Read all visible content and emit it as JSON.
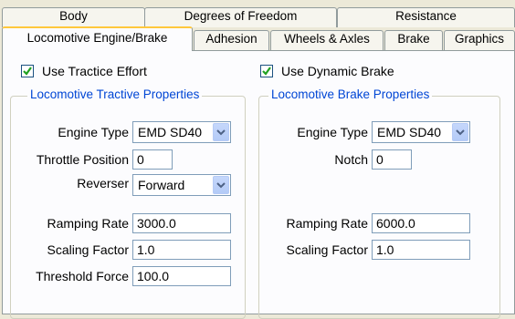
{
  "tabs_top": [
    {
      "label": "Body"
    },
    {
      "label": "Degrees of Freedom"
    },
    {
      "label": "Resistance"
    }
  ],
  "tabs_bottom": [
    {
      "label": "Locomotive Engine/Brake",
      "active": true
    },
    {
      "label": "Adhesion"
    },
    {
      "label": "Wheels & Axles"
    },
    {
      "label": "Brake"
    },
    {
      "label": "Graphics"
    }
  ],
  "tractive": {
    "checkbox_label": "Use Tractice Effort",
    "checked": true,
    "group_title": "Locomotive Tractive Properties",
    "engine_type_label": "Engine Type",
    "engine_type_value": "EMD SD40",
    "throttle_label": "Throttle Position",
    "throttle_value": "0",
    "reverser_label": "Reverser",
    "reverser_value": "Forward",
    "ramping_label": "Ramping Rate",
    "ramping_value": "3000.0",
    "scaling_label": "Scaling Factor",
    "scaling_value": "1.0",
    "threshold_label": "Threshold Force",
    "threshold_value": "100.0"
  },
  "brake": {
    "checkbox_label": "Use Dynamic Brake",
    "checked": true,
    "group_title": "Locomotive Brake Properties",
    "engine_type_label": "Engine Type",
    "engine_type_value": "EMD SD40",
    "notch_label": "Notch",
    "notch_value": "0",
    "ramping_label": "Ramping Rate",
    "ramping_value": "6000.0",
    "scaling_label": "Scaling Factor",
    "scaling_value": "1.0"
  },
  "colors": {
    "group_title": "#0046d5",
    "active_tab_accent": "#ffc83c",
    "check_mark": "#21a121"
  }
}
